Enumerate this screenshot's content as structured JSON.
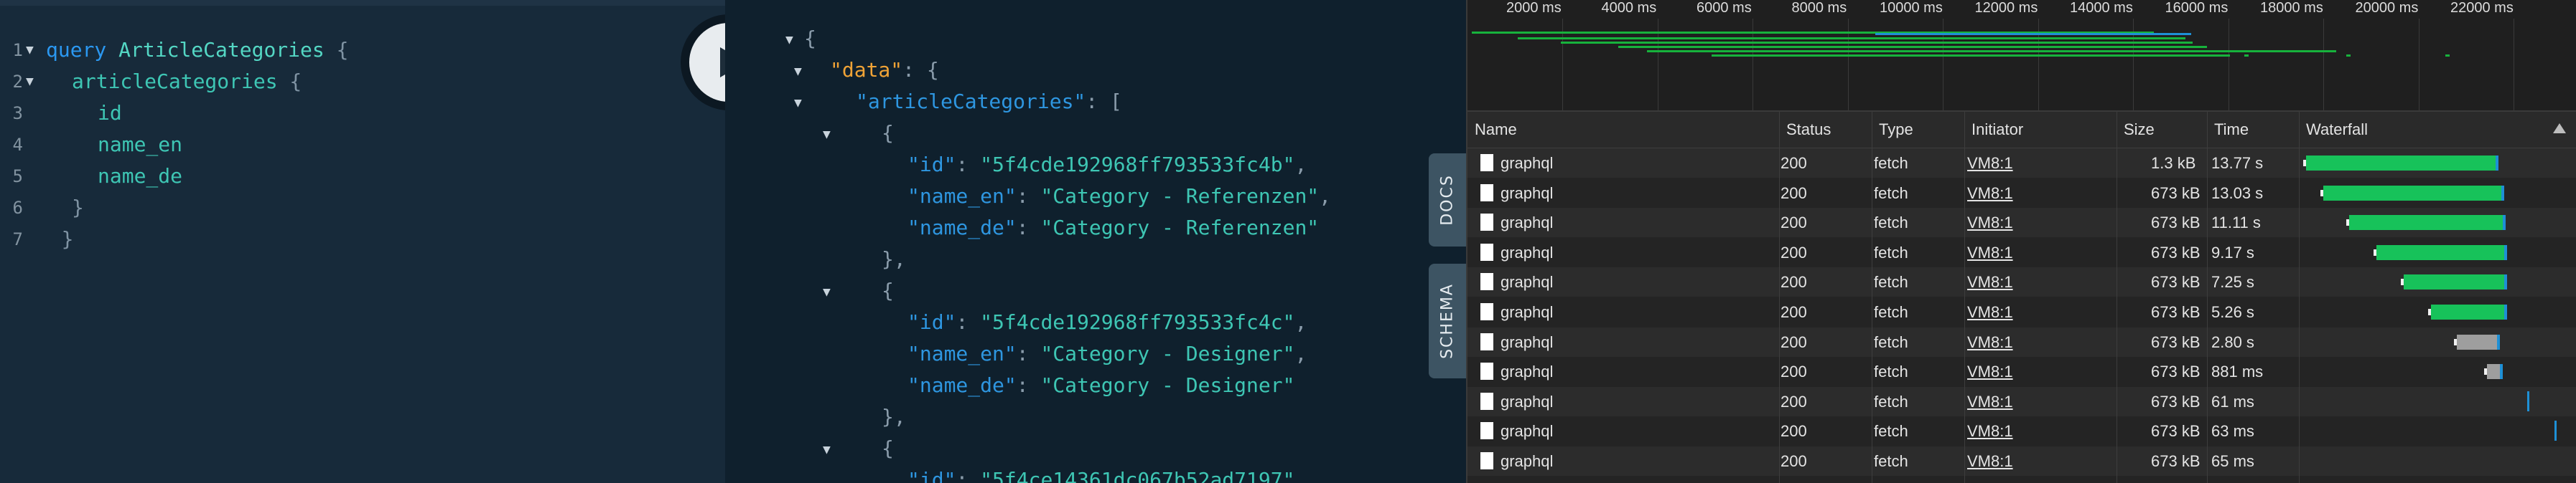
{
  "query": {
    "lines": [
      {
        "n": "1",
        "parts": [
          [
            "query",
            "kw"
          ],
          [
            " ",
            ""
          ],
          [
            "ArticleCategories",
            "name"
          ],
          [
            " {",
            "punct"
          ]
        ],
        "indent": 0,
        "fold": true
      },
      {
        "n": "2",
        "parts": [
          [
            "articleCategories",
            "field"
          ],
          [
            " {",
            "punct"
          ]
        ],
        "indent": 1,
        "fold": true
      },
      {
        "n": "3",
        "parts": [
          [
            "id",
            "field"
          ]
        ],
        "indent": 2,
        "fold": false
      },
      {
        "n": "4",
        "parts": [
          [
            "name_en",
            "field"
          ]
        ],
        "indent": 2,
        "fold": false
      },
      {
        "n": "5",
        "parts": [
          [
            "name_de",
            "field"
          ]
        ],
        "indent": 2,
        "fold": false
      },
      {
        "n": "6",
        "parts": [
          [
            "}",
            "punct"
          ]
        ],
        "indent": 1,
        "fold": false
      },
      {
        "n": "7",
        "parts": [
          [
            "}",
            "punct"
          ]
        ],
        "indent": 0.6,
        "fold": false
      }
    ]
  },
  "result": {
    "lines": [
      {
        "parts": [
          [
            "{",
            "p"
          ]
        ],
        "indent": 0,
        "fold": true
      },
      {
        "parts": [
          [
            "\"data\"",
            "dkey"
          ],
          [
            ": {",
            "p"
          ]
        ],
        "indent": 1,
        "fold": true
      },
      {
        "parts": [
          [
            "\"articleCategories\"",
            "key"
          ],
          [
            ": [",
            "p"
          ]
        ],
        "indent": 2,
        "fold": true
      },
      {
        "parts": [
          [
            "{",
            "p"
          ]
        ],
        "indent": 3,
        "fold": true
      },
      {
        "parts": [
          [
            "\"id\"",
            "key"
          ],
          [
            ": ",
            "p"
          ],
          [
            "\"5f4cde192968ff793533fc4b\"",
            "str"
          ],
          [
            ",",
            "p"
          ]
        ],
        "indent": 4,
        "fold": false
      },
      {
        "parts": [
          [
            "\"name_en\"",
            "key"
          ],
          [
            ": ",
            "p"
          ],
          [
            "\"Category - Referenzen\"",
            "str"
          ],
          [
            ",",
            "p"
          ]
        ],
        "indent": 4,
        "fold": false
      },
      {
        "parts": [
          [
            "\"name_de\"",
            "key"
          ],
          [
            ": ",
            "p"
          ],
          [
            "\"Category - Referenzen\"",
            "str"
          ]
        ],
        "indent": 4,
        "fold": false
      },
      {
        "parts": [
          [
            "},",
            "p"
          ]
        ],
        "indent": 3,
        "fold": false
      },
      {
        "parts": [
          [
            "{",
            "p"
          ]
        ],
        "indent": 3,
        "fold": true
      },
      {
        "parts": [
          [
            "\"id\"",
            "key"
          ],
          [
            ": ",
            "p"
          ],
          [
            "\"5f4cde192968ff793533fc4c\"",
            "str"
          ],
          [
            ",",
            "p"
          ]
        ],
        "indent": 4,
        "fold": false
      },
      {
        "parts": [
          [
            "\"name_en\"",
            "key"
          ],
          [
            ": ",
            "p"
          ],
          [
            "\"Category - Designer\"",
            "str"
          ],
          [
            ",",
            "p"
          ]
        ],
        "indent": 4,
        "fold": false
      },
      {
        "parts": [
          [
            "\"name_de\"",
            "key"
          ],
          [
            ": ",
            "p"
          ],
          [
            "\"Category - Designer\"",
            "str"
          ]
        ],
        "indent": 4,
        "fold": false
      },
      {
        "parts": [
          [
            "},",
            "p"
          ]
        ],
        "indent": 3,
        "fold": false
      },
      {
        "parts": [
          [
            "{",
            "p"
          ]
        ],
        "indent": 3,
        "fold": true
      },
      {
        "parts": [
          [
            "\"id\"",
            "key"
          ],
          [
            ": ",
            "p"
          ],
          [
            "\"5f4ce14361dc067b52ad7197\"",
            "str"
          ],
          [
            ",",
            "p"
          ]
        ],
        "indent": 4,
        "fold": false
      }
    ]
  },
  "side_tabs": {
    "docs": "DOCS",
    "schema": "SCHEMA"
  },
  "overview": {
    "ticks": [
      "2000 ms",
      "4000 ms",
      "6000 ms",
      "8000 ms",
      "10000 ms",
      "12000 ms",
      "14000 ms",
      "16000 ms",
      "18000 ms",
      "20000 ms",
      "22000 ms"
    ]
  },
  "network": {
    "columns": {
      "name": "Name",
      "status": "Status",
      "type": "Type",
      "initiator": "Initiator",
      "size": "Size",
      "time": "Time",
      "waterfall": "Waterfall"
    },
    "rows": [
      {
        "name": "graphql",
        "status": "200",
        "type": "fetch",
        "initiator": "VM8:1",
        "size": "1.3 kB",
        "time": "13.77 s"
      },
      {
        "name": "graphql",
        "status": "200",
        "type": "fetch",
        "initiator": "VM8:1",
        "size": "673 kB",
        "time": "13.03 s"
      },
      {
        "name": "graphql",
        "status": "200",
        "type": "fetch",
        "initiator": "VM8:1",
        "size": "673 kB",
        "time": "11.11 s"
      },
      {
        "name": "graphql",
        "status": "200",
        "type": "fetch",
        "initiator": "VM8:1",
        "size": "673 kB",
        "time": "9.17 s"
      },
      {
        "name": "graphql",
        "status": "200",
        "type": "fetch",
        "initiator": "VM8:1",
        "size": "673 kB",
        "time": "7.25 s"
      },
      {
        "name": "graphql",
        "status": "200",
        "type": "fetch",
        "initiator": "VM8:1",
        "size": "673 kB",
        "time": "5.26 s"
      },
      {
        "name": "graphql",
        "status": "200",
        "type": "fetch",
        "initiator": "VM8:1",
        "size": "673 kB",
        "time": "2.80 s"
      },
      {
        "name": "graphql",
        "status": "200",
        "type": "fetch",
        "initiator": "VM8:1",
        "size": "673 kB",
        "time": "881 ms"
      },
      {
        "name": "graphql",
        "status": "200",
        "type": "fetch",
        "initiator": "VM8:1",
        "size": "673 kB",
        "time": "61 ms"
      },
      {
        "name": "graphql",
        "status": "200",
        "type": "fetch",
        "initiator": "VM8:1",
        "size": "673 kB",
        "time": "63 ms"
      },
      {
        "name": "graphql",
        "status": "200",
        "type": "fetch",
        "initiator": "VM8:1",
        "size": "673 kB",
        "time": "65 ms"
      }
    ]
  },
  "colors": {
    "editor_bg": "#172a3a",
    "result_bg": "#0f202d",
    "keyword": "#2b98f1",
    "field": "#3ec6b4",
    "data_key": "#f0a336",
    "bar_green": "#17c25a",
    "bar_blue": "#1e90d6"
  }
}
